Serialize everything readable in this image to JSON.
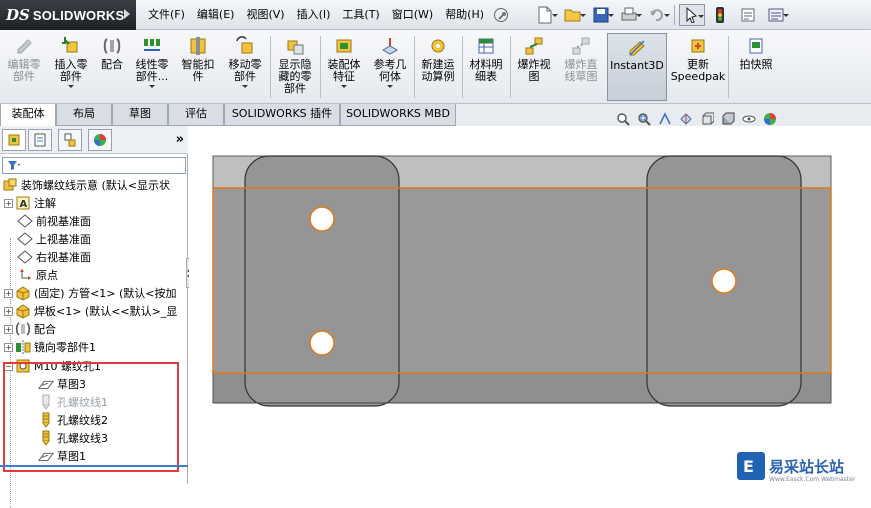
{
  "app": {
    "logo_ds": "DS",
    "logo_name": "SOLIDWORKS"
  },
  "menu": {
    "items": [
      "文件(F)",
      "编辑(E)",
      "视图(V)",
      "插入(I)",
      "工具(T)",
      "窗口(W)",
      "帮助(H)"
    ]
  },
  "ribbon": {
    "buttons": [
      {
        "label": "编辑零\n部件",
        "icon": "edit-component-icon",
        "disabled": true
      },
      {
        "label": "插入零\n部件",
        "icon": "insert-component-icon",
        "disabled": false
      },
      {
        "label": "配合",
        "icon": "mate-icon",
        "disabled": false
      },
      {
        "label": "线性零\n部件...",
        "icon": "linear-pattern-icon",
        "disabled": false
      },
      {
        "label": "智能扣\n件",
        "icon": "smart-fasteners-icon",
        "disabled": false
      },
      {
        "label": "移动零\n部件",
        "icon": "move-component-icon",
        "disabled": false
      },
      {
        "label": "显示隐\n藏的零\n部件",
        "icon": "show-hidden-icon",
        "disabled": false
      },
      {
        "label": "装配体\n特征",
        "icon": "assembly-feature-icon",
        "disabled": false
      },
      {
        "label": "参考几\n何体",
        "icon": "reference-geometry-icon",
        "disabled": false
      },
      {
        "label": "新建运\n动算例",
        "icon": "motion-study-icon",
        "disabled": false
      },
      {
        "label": "材料明\n细表",
        "icon": "bom-icon",
        "disabled": false
      },
      {
        "label": "爆炸视\n图",
        "icon": "exploded-view-icon",
        "disabled": false
      },
      {
        "label": "爆炸直\n线草图",
        "icon": "explode-line-icon",
        "disabled": true
      },
      {
        "label": "Instant3D",
        "icon": "instant3d-icon",
        "disabled": false,
        "active": true
      },
      {
        "label": "更新\nSpeedpak",
        "icon": "speedpak-icon",
        "disabled": false
      },
      {
        "label": "拍快照",
        "icon": "snapshot-icon",
        "disabled": false
      }
    ]
  },
  "tabs": [
    "装配体",
    "布局",
    "草图",
    "评估",
    "SOLIDWORKS 插件",
    "SOLIDWORKS MBD"
  ],
  "tree": {
    "expand_symbol": "+",
    "collapse_symbol": "−",
    "pane_expand": "»",
    "root": "装饰螺纹线示意 (默认<显示状",
    "nodes": [
      {
        "label": "注解",
        "icon": "annotation-icon",
        "expand": "+"
      },
      {
        "label": "前视基准面",
        "icon": "plane-icon"
      },
      {
        "label": "上视基准面",
        "icon": "plane-icon"
      },
      {
        "label": "右视基准面",
        "icon": "plane-icon"
      },
      {
        "label": "原点",
        "icon": "origin-icon"
      },
      {
        "label": "(固定) 方管<1> (默认<按加",
        "icon": "part-icon",
        "expand": "+"
      },
      {
        "label": "焊板<1> (默认<<默认>_显",
        "icon": "part-icon",
        "expand": "+"
      },
      {
        "label": "配合",
        "icon": "mates-icon",
        "expand": "+"
      },
      {
        "label": "镜向零部件1",
        "icon": "mirror-component-icon",
        "expand": "+"
      },
      {
        "label": "M10 螺纹孔1",
        "icon": "hole-feature-icon",
        "expand": "−"
      },
      {
        "label": "草图3",
        "icon": "sketch-icon",
        "child": true
      },
      {
        "label": "孔螺纹线1",
        "icon": "thread-icon",
        "child": true,
        "grey": true
      },
      {
        "label": "孔螺纹线2",
        "icon": "thread-icon",
        "child": true
      },
      {
        "label": "孔螺纹线3",
        "icon": "thread-icon",
        "child": true
      },
      {
        "label": "草图1",
        "icon": "sketch-icon",
        "child": true
      }
    ]
  },
  "watermark": {
    "text": "易采站长站",
    "sub": "Www.Easck.Com Webmaster"
  },
  "colors": {
    "part_fill": "#8e8e8e",
    "part_top": "#b9b9b9",
    "edge_highlight": "#e07a17",
    "selection_box": "#e53b3b",
    "hole_fill": "#ffffff",
    "hole_stroke": "#e07a17"
  }
}
